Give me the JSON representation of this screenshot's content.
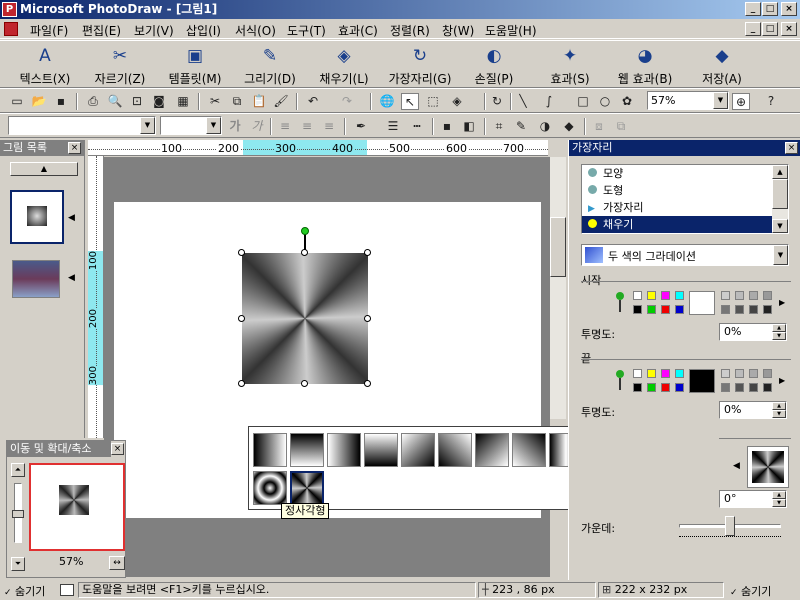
{
  "window": {
    "title": "Microsoft PhotoDraw - [그림1]"
  },
  "menu": [
    "파일(F)",
    "편집(E)",
    "보기(V)",
    "삽입(I)",
    "서식(O)",
    "도구(T)",
    "효과(C)",
    "정렬(R)",
    "창(W)",
    "도움말(H)"
  ],
  "big_toolbar": [
    {
      "label": "텍스트(X)",
      "icon": "A"
    },
    {
      "label": "자르기(Z)",
      "icon": "✂"
    },
    {
      "label": "템플릿(M)",
      "icon": "▣"
    },
    {
      "label": "그리기(D)",
      "icon": "✎"
    },
    {
      "label": "채우기(L)",
      "icon": "◈"
    },
    {
      "label": "가장자리(G)",
      "icon": "↻"
    },
    {
      "label": "손질(P)",
      "icon": "◐"
    },
    {
      "label": "효과(S)",
      "icon": "✦"
    },
    {
      "label": "웹 효과(B)",
      "icon": "◕"
    },
    {
      "label": "저장(A)",
      "icon": "◆"
    }
  ],
  "zoom_combo": "57%",
  "format_bar": {
    "bold": "가",
    "italic": "가"
  },
  "picture_list": {
    "title": "그림 목록"
  },
  "ruler": {
    "ticks": [
      "100",
      "200",
      "300",
      "400",
      "500",
      "600",
      "700"
    ],
    "vticks": [
      "100",
      "200",
      "300"
    ]
  },
  "pan_zoom": {
    "title": "이동 및 확대/축소",
    "zoom": "57%"
  },
  "right_panel": {
    "title": "가장자리",
    "list": [
      "모양",
      "도형",
      "가장자리",
      "채우기"
    ],
    "fill_type": "두 색의 그라데이션",
    "start_label": "시작",
    "end_label": "끝",
    "transparency_label": "투명도:",
    "start_transparency": "0%",
    "end_transparency": "0%",
    "angle": "0°",
    "center_label": "가운데:"
  },
  "gradient_tooltip": "정사각형",
  "status": {
    "hide_left": "숨기기",
    "help": "도움말을 보려면 <F1>키를 누르십시오.",
    "coords": "223 , 86  px",
    "size": "222 x 232  px",
    "hide_right": "숨기기"
  }
}
